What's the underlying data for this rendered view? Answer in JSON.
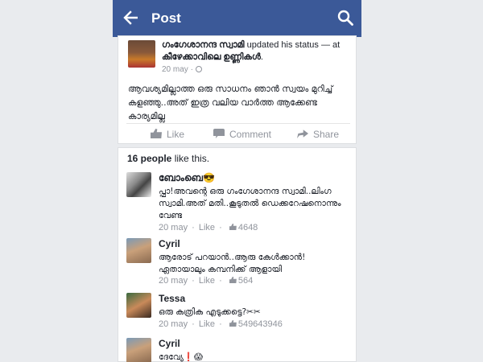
{
  "header": {
    "title": "Post",
    "back_icon": "arrow-left-icon",
    "search_icon": "search-icon",
    "background": "#3b5998"
  },
  "post": {
    "author": "ഗംഗേശാനന്ദ സ്വാമി",
    "action": " updated his status — at ",
    "place": "കീഴേക്കാവിലെ ഉണ്ണികൾ",
    "place_suffix": ".",
    "date": "20 may ·",
    "text": "ആവശ്യമില്ലാത്ത ഒരു സാധനം ഞാൻ സ്വയം മുറിച്ച് കളഞ്ഞു..അത് ഇത്ര വലിയ വാർത്ത ആക്കേണ്ട കാര്യമില്ല",
    "actions": {
      "like": "Like",
      "comment": "Comment",
      "share": "Share"
    }
  },
  "likes": {
    "count": "16 people",
    "suffix": " like this."
  },
  "comments": [
    {
      "name": "ബോംബെ😎",
      "text": "പ്ഫാ!അവന്റെ ഒരു ഗംഗേശാനന്ദ സ്വാമി..ലിംഗ സ്വാമി.അത് മതി..കൂടുതൽ ഡെക്കറേഷനൊന്നും വേണ്ട",
      "date": "20 may",
      "like": "Like",
      "likes": "4648"
    },
    {
      "name": "Cyril",
      "text": "ആരോട് പറയാൻ..ആരു കേൾക്കാൻ! ഏതായാലും കമ്പനിക്ക് ആളായി",
      "date": "20 may",
      "like": "Like",
      "likes": "564"
    },
    {
      "name": "Tessa",
      "text": "ഒരു കത്രിക എടുക്കട്ടെ?✂✂",
      "date": "20 may",
      "like": "Like",
      "likes": "549643946"
    },
    {
      "name": "Cyril",
      "text": "ദേവ്യേ❗😱",
      "date": "",
      "like": "",
      "likes": ""
    }
  ]
}
